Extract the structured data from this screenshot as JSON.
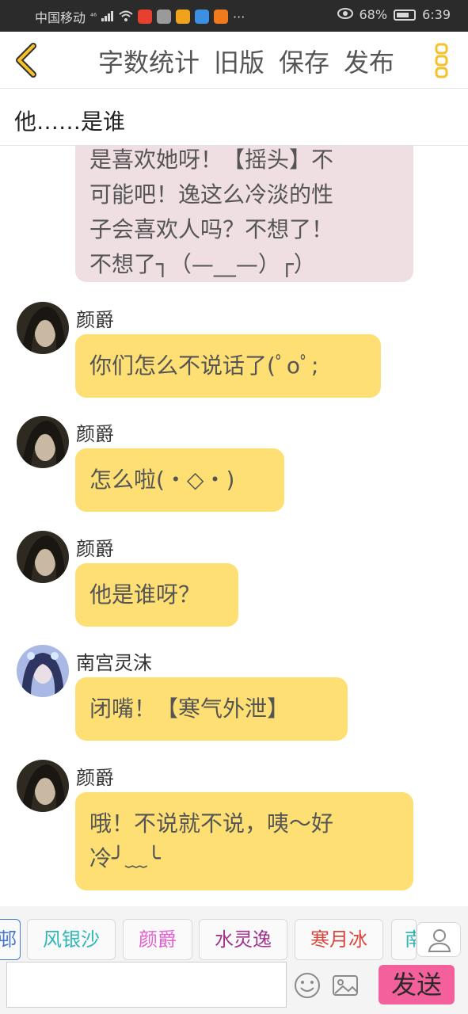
{
  "status_bar": {
    "carrier": "中国移动",
    "network": "⁴⁶",
    "battery": "68%",
    "time": "6:39",
    "more": "···"
  },
  "header": {
    "back_icon": "chevron-left-icon",
    "actions": [
      "字数统计",
      "旧版",
      "保存",
      "发布"
    ],
    "more_icon": "vertical-dots-icon",
    "accent": "#f5c22a"
  },
  "title": "他……是谁",
  "messages": [
    {
      "lines": [
        "是喜欢她呀！【摇头】不",
        "可能吧！逸这么冷淡的性",
        "子会喜欢人吗？不想了！",
        "不想了┐（—__—）┌）"
      ],
      "style": "pink"
    },
    {
      "author": "颜爵",
      "lines": [
        "你们怎么不说话了(ﾟoﾟ;"
      ]
    },
    {
      "author": "颜爵",
      "lines": [
        "怎么啦(・◇・)"
      ]
    },
    {
      "author": "颜爵",
      "lines": [
        "他是谁呀？"
      ]
    },
    {
      "author": "南宫灵沫",
      "lines": [
        "闭嘴！【寒气外泄】"
      ]
    },
    {
      "author": "颜爵",
      "lines": [
        "哦！不说就不说，咦～好",
        "冷╯﹏╰"
      ]
    }
  ],
  "roles": [
    {
      "label": "邨",
      "color": "#4a78c9"
    },
    {
      "label": "风银沙",
      "color": "#2fb6b6"
    },
    {
      "label": "颜爵",
      "color": "#e25fd0"
    },
    {
      "label": "水灵逸",
      "color": "#a0348f"
    },
    {
      "label": "寒月冰",
      "color": "#d9453d"
    },
    {
      "label": "南",
      "color": "#2fb6b6"
    }
  ],
  "input": {
    "placeholder": "",
    "value": ""
  },
  "send_label": "发送",
  "colors": {
    "bubble": "#fedf73",
    "bubble_pink": "#efdfe2",
    "send": "#f4609b"
  }
}
